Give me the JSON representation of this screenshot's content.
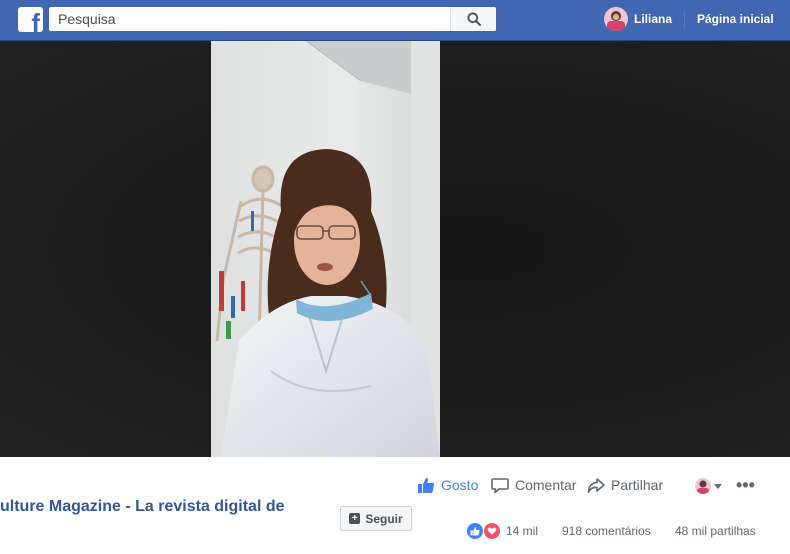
{
  "topbar": {
    "logo": "f",
    "search_placeholder": "Pesquisa",
    "user_name": "Liliana",
    "home_label": "Página inicial"
  },
  "icons": {
    "logo": "facebook-logo-icon",
    "search": "search-icon",
    "like": "thumbs-up-icon",
    "comment": "comment-bubble-icon",
    "share": "share-arrow-icon",
    "more": "more-dots-icon",
    "caret": "chevron-down-icon"
  },
  "colors": {
    "brand": "#4267b2",
    "link": "#365899",
    "like_blue": "#4080ff",
    "love_red": "#f25268"
  },
  "post": {
    "page_title": "ulture Magazine - La revista digital de",
    "follow_label": "Seguir",
    "follow_plus": "+"
  },
  "actions": {
    "like_label": "Gosto",
    "comment_label": "Comentar",
    "share_label": "Partilhar",
    "more_label": "•••"
  },
  "stats": {
    "reactions_count": "14 mil",
    "comments": "918 comentários",
    "shares": "48 mil partilhas"
  }
}
